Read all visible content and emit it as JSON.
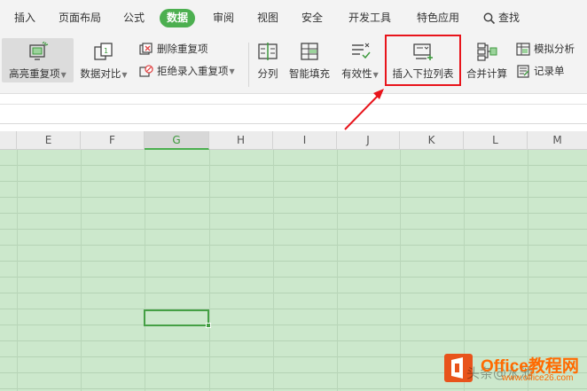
{
  "tabs": {
    "items": [
      "插入",
      "页面布局",
      "公式",
      "数据",
      "审阅",
      "视图",
      "安全",
      "开发工具",
      "特色应用"
    ],
    "active": "数据",
    "search_label": "查找"
  },
  "ribbon": {
    "highlight_dup": "高亮重复项",
    "data_compare": "数据对比",
    "delete_dup": "删除重复项",
    "reject_dup": "拒绝录入重复项",
    "split_col": "分列",
    "smart_fill": "智能填充",
    "validity": "有效性",
    "insert_dropdown": "插入下拉列表",
    "merge_calc": "合并计算",
    "simulate": "模拟分析",
    "record_sheet": "记录单"
  },
  "columns": [
    "E",
    "F",
    "G",
    "H",
    "I",
    "J",
    "K",
    "L",
    "M"
  ],
  "active_column": "G",
  "watermark": {
    "brand": "Office教程网",
    "site": "www.office26.com",
    "faded": "头条@水池"
  },
  "colors": {
    "accent": "#4caf50",
    "sheet_bg": "#cce8cc",
    "highlight_red": "#e8141b",
    "brand_orange": "#ff6a00"
  }
}
